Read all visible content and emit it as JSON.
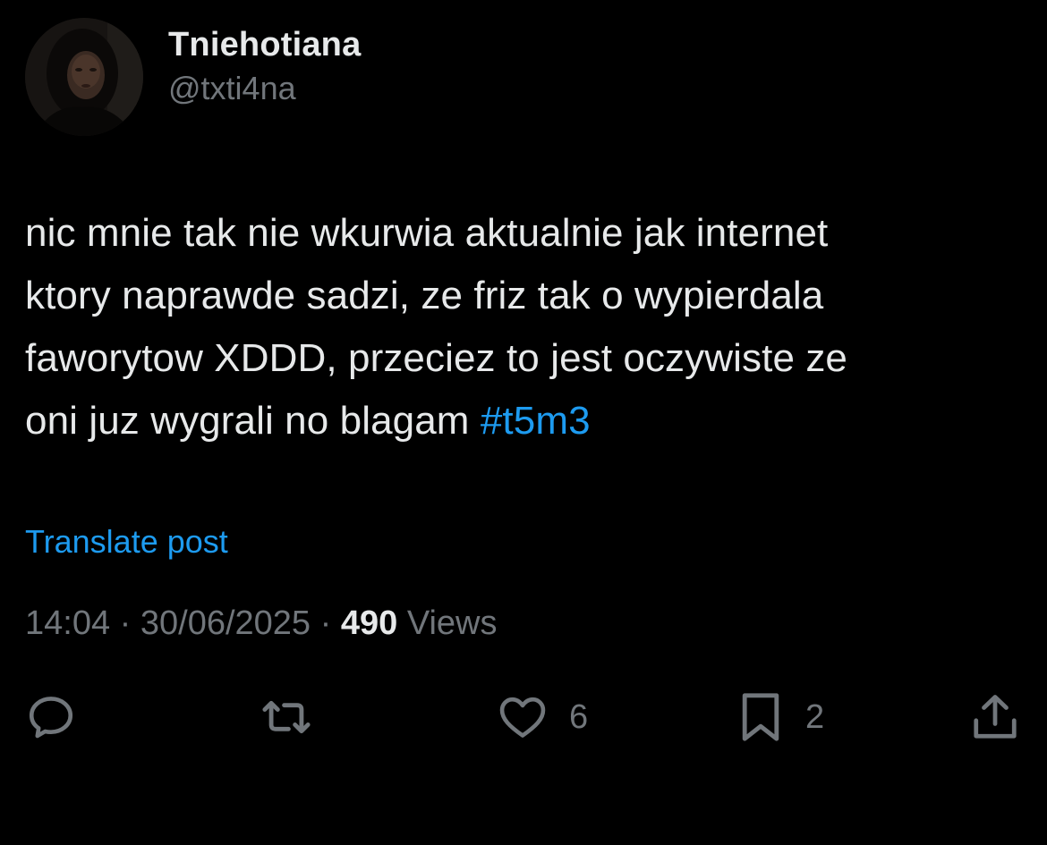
{
  "tweet": {
    "author": {
      "display_name": "Tniehotiana",
      "handle": "@txti4na",
      "avatar_icon": "profile-photo"
    },
    "text_lines": [
      "nic mnie tak nie wkurwia aktualnie jak internet",
      "ktory naprawde sadzi, ze friz tak o wypierdala",
      "faworytow XDDD, przeciez to jest oczywiste ze",
      "oni juz wygrali no blagam "
    ],
    "hashtag": "#t5m3",
    "translate_label": "Translate post",
    "time": "14:04",
    "date": "30/06/2025",
    "separator": "·",
    "views_count": "490",
    "views_label": "Views"
  },
  "actions": {
    "reply": {
      "icon": "reply-icon"
    },
    "retweet": {
      "icon": "retweet-icon"
    },
    "like": {
      "icon": "heart-icon",
      "count": "6"
    },
    "bookmark": {
      "icon": "bookmark-icon",
      "count": "2"
    },
    "share": {
      "icon": "share-icon"
    }
  },
  "colors": {
    "background": "#000000",
    "text_primary": "#e7e9ea",
    "text_secondary": "#71767b",
    "accent": "#1d9bf0"
  }
}
